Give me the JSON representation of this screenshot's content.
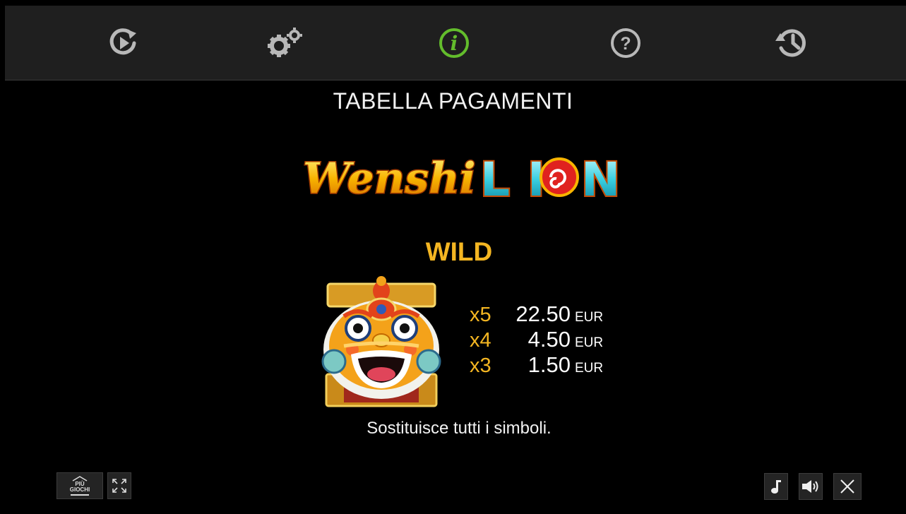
{
  "nav": {
    "items": [
      {
        "name": "autoplay",
        "icon": "play-refresh-icon",
        "active": false
      },
      {
        "name": "settings",
        "icon": "gears-icon",
        "active": false
      },
      {
        "name": "info",
        "icon": "info-icon",
        "active": true
      },
      {
        "name": "help",
        "icon": "question-icon",
        "active": false
      },
      {
        "name": "history",
        "icon": "history-icon",
        "active": false
      }
    ],
    "active_color": "#63bd2c",
    "inactive_color": "#b8b8b8"
  },
  "paytable": {
    "title": "TABELLA PAGAMENTI",
    "logo_text_1": "Wenshi",
    "logo_text_2": "LION",
    "symbol_name": "WILD",
    "rows": [
      {
        "mult": "x5",
        "amount": "22.50",
        "currency": "EUR"
      },
      {
        "mult": "x4",
        "amount": "4.50",
        "currency": "EUR"
      },
      {
        "mult": "x3",
        "amount": "1.50",
        "currency": "EUR"
      }
    ],
    "description": "Sostituisce tutti i simboli."
  },
  "bottom_left": {
    "more_games_label_1": "PIÙ",
    "more_games_label_2": "GIOCHI",
    "fullscreen_icon": "expand-icon"
  },
  "bottom_right": {
    "music_icon": "music-note-icon",
    "sound_icon": "speaker-icon",
    "close_icon": "close-icon"
  },
  "colors": {
    "gold": "#f4b622",
    "topbar": "#1f1f1f"
  }
}
